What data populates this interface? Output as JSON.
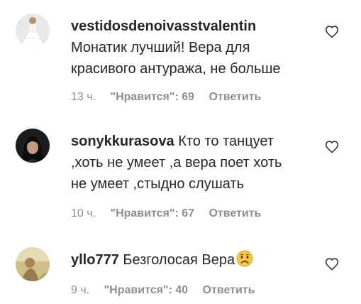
{
  "comments": [
    {
      "username": "vestidosdenoivasstvalentin",
      "text_lines": [
        "Монатик лучший! Вера для",
        "красивого антуража, не больше"
      ],
      "time": "13 ч.",
      "likes_label": "\"Нравится\": 69",
      "reply_label": "Ответить",
      "avatar_icon": "bride-dress-avatar",
      "like_icon": "heart-outline-icon"
    },
    {
      "username": "sonykkurasova",
      "text_first": "Кто то танцует",
      "text_lines": [
        ",хоть не умеет ,а вера поет хоть",
        "не умеет ,стыдно слушать"
      ],
      "time": "10 ч.",
      "likes_label": "\"Нравится\": 67",
      "reply_label": "Ответить",
      "avatar_icon": "woman-portrait-avatar",
      "like_icon": "heart-outline-icon"
    },
    {
      "username": "yllo777",
      "text_first": "Безголосая Вера",
      "emoji": "sad-face-emoji",
      "time": "9 ч.",
      "likes_label": "\"Нравится\": 40",
      "reply_label": "Ответить",
      "avatar_icon": "outdoor-photo-avatar",
      "like_icon": "heart-outline-icon"
    }
  ],
  "colors": {
    "text": "#262626",
    "secondary": "#8e8e8e",
    "emoji_face": "#f6c64a"
  }
}
